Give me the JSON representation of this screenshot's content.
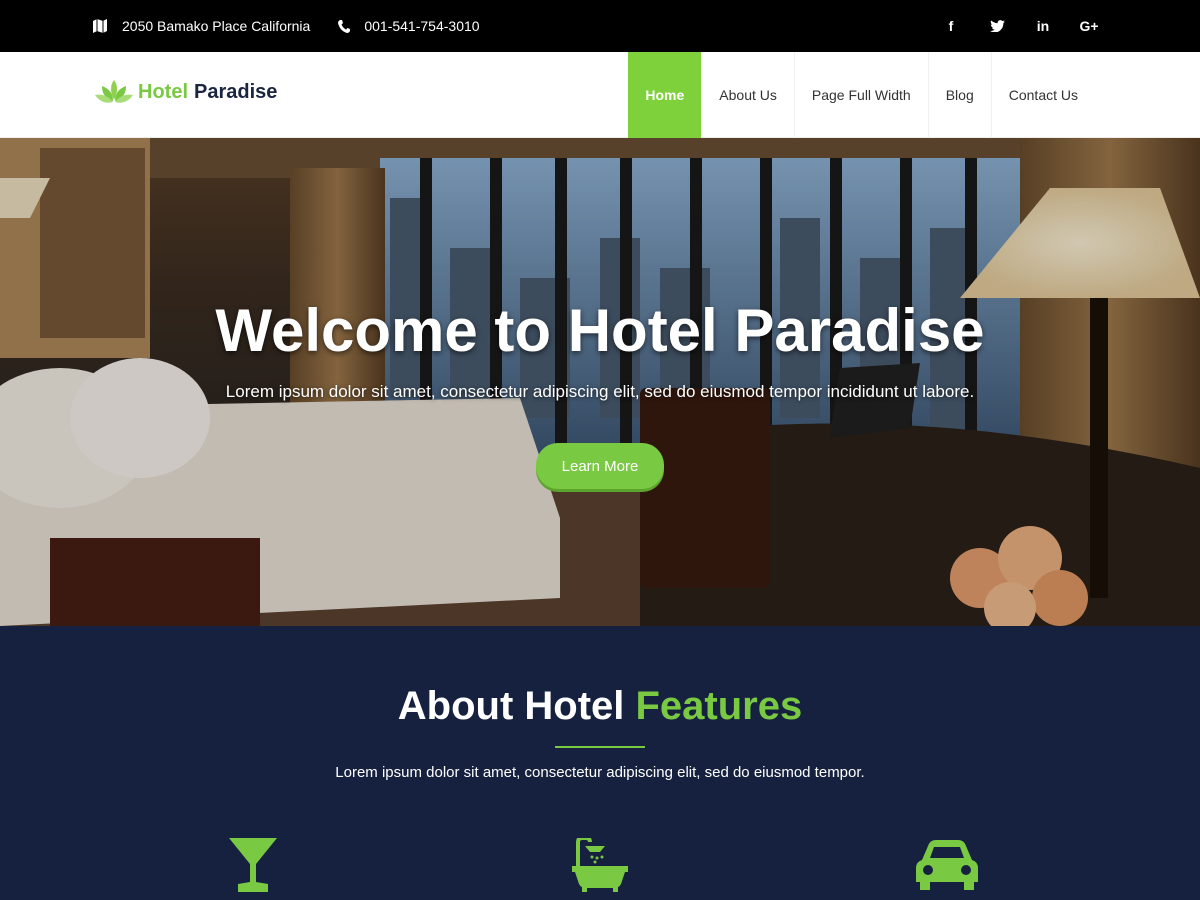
{
  "topbar": {
    "address": "2050 Bamako Place California",
    "phone": "001-541-754-3010",
    "social": [
      {
        "icon": "facebook-icon",
        "glyph": "f"
      },
      {
        "icon": "twitter-icon",
        "glyph": ""
      },
      {
        "icon": "linkedin-icon",
        "glyph": "in"
      },
      {
        "icon": "google-plus-icon",
        "glyph": "G+"
      }
    ]
  },
  "header": {
    "logo_part1": "Hotel",
    "logo_part2": "Paradise",
    "nav": [
      {
        "label": "Home",
        "active": true
      },
      {
        "label": "About Us",
        "active": false
      },
      {
        "label": "Page Full Width",
        "active": false
      },
      {
        "label": "Blog",
        "active": false
      },
      {
        "label": "Contact Us",
        "active": false
      }
    ]
  },
  "hero": {
    "title": "Welcome to Hotel Paradise",
    "subtitle": "Lorem ipsum dolor sit amet, consectetur adipiscing elit, sed do eiusmod tempor incididunt ut labore.",
    "button": "Learn More"
  },
  "about": {
    "title_part1": "About Hotel",
    "title_part2": "Features",
    "text": "Lorem ipsum dolor sit amet, consectetur adipiscing elit, sed do eiusmod tempor.",
    "features": [
      {
        "icon": "cocktail-icon"
      },
      {
        "icon": "bathtub-icon"
      },
      {
        "icon": "car-icon"
      }
    ]
  },
  "colors": {
    "accent": "#7ac943",
    "dark_navy": "#15213e",
    "topbar": "#000000"
  }
}
